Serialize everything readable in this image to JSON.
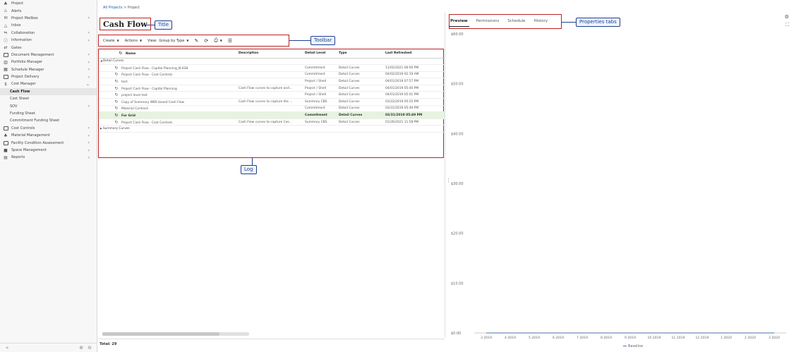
{
  "sidebar": {
    "items": [
      {
        "label": "Project",
        "icon": "project-icon",
        "chevron": false,
        "sub": false,
        "active": false
      },
      {
        "label": "Alerts",
        "icon": "alert-icon",
        "chevron": false,
        "sub": false,
        "active": false
      },
      {
        "label": "Project Mailbox",
        "icon": "mailbox-icon",
        "chevron": true,
        "sub": false,
        "active": false
      },
      {
        "label": "Inbox",
        "icon": "inbox-icon",
        "chevron": false,
        "sub": false,
        "active": false
      },
      {
        "label": "Collaboration",
        "icon": "collaboration-icon",
        "chevron": true,
        "sub": false,
        "active": false
      },
      {
        "label": "Information",
        "icon": "info-icon",
        "chevron": true,
        "sub": false,
        "active": false
      },
      {
        "label": "Gates",
        "icon": "gates-icon",
        "chevron": false,
        "sub": false,
        "active": false
      },
      {
        "label": "Document Management",
        "icon": "folder-icon",
        "chevron": true,
        "sub": false,
        "active": false
      },
      {
        "label": "Portfolio Manager",
        "icon": "portfolio-icon",
        "chevron": true,
        "sub": false,
        "active": false
      },
      {
        "label": "Schedule Manager",
        "icon": "schedule-icon",
        "chevron": true,
        "sub": false,
        "active": false
      },
      {
        "label": "Project Delivery",
        "icon": "folder-icon",
        "chevron": true,
        "sub": false,
        "active": false
      },
      {
        "label": "Cost Manager",
        "icon": "cost-icon",
        "chevron": "down",
        "sub": false,
        "active": false
      },
      {
        "label": "Cash Flow",
        "icon": "",
        "chevron": false,
        "sub": true,
        "active": true
      },
      {
        "label": "Cost Sheet",
        "icon": "",
        "chevron": false,
        "sub": true,
        "active": false
      },
      {
        "label": "SOV",
        "icon": "",
        "chevron": true,
        "sub": true,
        "active": false
      },
      {
        "label": "Funding Sheet",
        "icon": "",
        "chevron": false,
        "sub": true,
        "active": false
      },
      {
        "label": "Commitment Funding Sheet",
        "icon": "",
        "chevron": false,
        "sub": true,
        "active": false
      },
      {
        "label": "Cost Controls",
        "icon": "folder-icon",
        "chevron": true,
        "sub": false,
        "active": false
      },
      {
        "label": "Material Management",
        "icon": "material-icon",
        "chevron": true,
        "sub": false,
        "active": false
      },
      {
        "label": "Facility Condition Assessment",
        "icon": "folder-icon",
        "chevron": true,
        "sub": false,
        "active": false
      },
      {
        "label": "Space Management",
        "icon": "space-icon",
        "chevron": true,
        "sub": false,
        "active": false
      },
      {
        "label": "Reports",
        "icon": "reports-icon",
        "chevron": true,
        "sub": false,
        "active": false
      }
    ],
    "footer_left": "«",
    "footer_zoom_in": "⊕",
    "footer_zoom_out": "⊖"
  },
  "breadcrumb": {
    "parent": "All Projects",
    "separator": ">",
    "current": "Project"
  },
  "page_title": "Cash Flow",
  "toolbar": {
    "create_label": "Create",
    "actions_label": "Actions",
    "view_label": "View:",
    "view_value": "Group by Type"
  },
  "grid": {
    "columns": [
      "Name",
      "Description",
      "Detail Level",
      "Type",
      "Last Refreshed"
    ],
    "group_detail": "Detail Curves",
    "group_summary": "Summary Curves",
    "rows": [
      {
        "name": "Project Cash Flow - Capital Planning_N-038",
        "description": "",
        "level": "Commitment",
        "type": "Detail Curves",
        "refreshed": "11/02/2021 06:00 PM",
        "highlight": false
      },
      {
        "name": "Project Cash Flow - Cost Controls",
        "description": "",
        "level": "Commitment",
        "type": "Detail Curves",
        "refreshed": "04/02/2019 02:19 AM",
        "highlight": false
      },
      {
        "name": "test",
        "description": "",
        "level": "Project / Shell",
        "type": "Detail Curves",
        "refreshed": "04/01/2019 07:57 PM",
        "highlight": false
      },
      {
        "name": "Project Cash Flow - Capital Planning",
        "description": "Cash Flow curves to capture and...",
        "level": "Project / Shell",
        "type": "Detail Curves",
        "refreshed": "04/01/2019 05:40 PM",
        "highlight": false
      },
      {
        "name": "project level test",
        "description": "",
        "level": "Project / Shell",
        "type": "Detail Curves",
        "refreshed": "04/01/2019 05:01 PM",
        "highlight": false
      },
      {
        "name": "Copy of Summary WBS based Cash Flow",
        "description": "Cash Flow curves to capture the ...",
        "level": "Summary CBS",
        "type": "Detail Curves",
        "refreshed": "03/22/2019 05:25 PM",
        "highlight": false
      },
      {
        "name": "Material Contract",
        "description": "",
        "level": "Commitment",
        "type": "Detail Curves",
        "refreshed": "03/31/2019 05:49 PM",
        "highlight": false
      },
      {
        "name": "For Grid",
        "description": "",
        "level": "Commitment",
        "type": "Detail Curves",
        "refreshed": "03/31/2019 05:49 PM",
        "highlight": true
      },
      {
        "name": "Project Cash Flow - Cost Controls",
        "description": "Cash Flow curves to capture Cos...",
        "level": "Summary CBS",
        "type": "Detail Curves",
        "refreshed": "01/26/2021 11:58 PM",
        "highlight": false
      }
    ],
    "total": "Total: 29"
  },
  "callouts": {
    "title": "Title",
    "toolbar": "Toolbar",
    "log": "Log",
    "tabs": "Properties tabs"
  },
  "tabs": [
    "Preview",
    "Permissions",
    "Schedule",
    "History"
  ],
  "chart_data": {
    "type": "line",
    "title": "",
    "xlabel": "",
    "ylabel": "",
    "y_tick_labels": [
      "$60.00",
      "$50.00",
      "$40.00",
      "$30.00",
      "$20.00",
      "$10.00",
      "$0.00"
    ],
    "y_ticks": [
      60,
      50,
      40,
      30,
      20,
      10,
      0
    ],
    "ylim": [
      0,
      60
    ],
    "categories": [
      "3 2019",
      "4 2019",
      "5 2019",
      "6 2019",
      "7 2019",
      "8 2019",
      "9 2019",
      "10 2019",
      "11 2019",
      "12 2019",
      "1 2020",
      "2 2020",
      "3 2020"
    ],
    "series": [
      {
        "name": "Baseline",
        "values": [
          0,
          0,
          0,
          0,
          0,
          0,
          0,
          0,
          0,
          0,
          0,
          0,
          0
        ],
        "color": "#4a6fb0"
      }
    ],
    "legend_position": "bottom",
    "grid": false
  }
}
